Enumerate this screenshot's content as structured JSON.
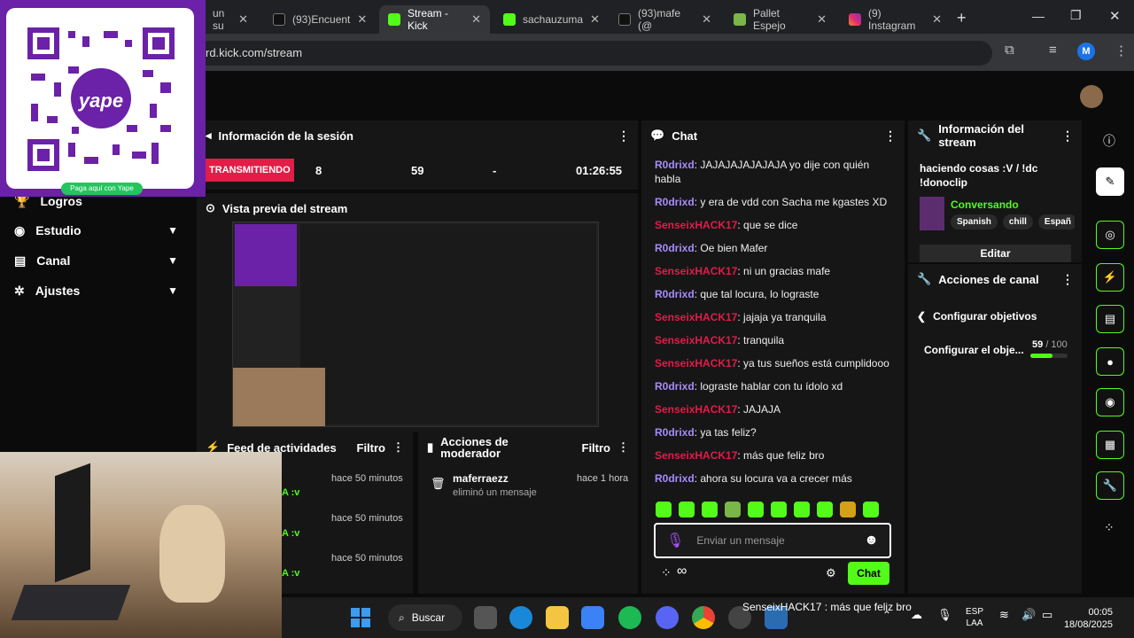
{
  "browser": {
    "tabs": [
      {
        "label": "un su",
        "icon": "globe"
      },
      {
        "label": "(93)Encuent",
        "icon": "tiktok"
      },
      {
        "label": "Stream - Kick",
        "icon": "kick",
        "active": true
      },
      {
        "label": "sachauzuma",
        "icon": "kick"
      },
      {
        "label": "(93)mafe (@",
        "icon": "tiktok"
      },
      {
        "label": "Pallet Espejo",
        "icon": "pallet"
      },
      {
        "label": "(9) Instagram",
        "icon": "instagram"
      }
    ],
    "url": "rd.kick.com/stream",
    "profile_initial": "M"
  },
  "qr": {
    "brand": "yape",
    "caption": "Paga aquí con Yape"
  },
  "sidebar": {
    "items": [
      {
        "label": "Logros"
      },
      {
        "label": "Estudio"
      },
      {
        "label": "Canal"
      },
      {
        "label": "Ajustes"
      }
    ]
  },
  "session": {
    "title": "Información de la sesión",
    "status": "TRANSMITIENDO",
    "viewers": "8",
    "followers": "59",
    "subs": "-",
    "time": "01:26:55"
  },
  "preview": {
    "title": "Vista previa del stream"
  },
  "feed": {
    "title": "Feed de actividades",
    "filter": "Filtro",
    "items": [
      {
        "time": "hace 50 minutos",
        "text": "A :v"
      },
      {
        "time": "hace 50 minutos",
        "text": "A :v"
      },
      {
        "time": "hace 50 minutos",
        "text": "A :v"
      }
    ]
  },
  "mod": {
    "title": "Acciones de moderador",
    "filter": "Filtro",
    "user": "maferraezz",
    "action": "eliminó un mensaje",
    "time": "hace 1 hora"
  },
  "chat": {
    "title": "Chat",
    "messages": [
      {
        "user": "R0drixd",
        "color": "#a78bfa",
        "text": "JAJAJAJAJAJAJA yo dije con quién habla"
      },
      {
        "user": "R0drixd",
        "color": "#a78bfa",
        "text": "y era de vdd con Sacha me kgastes XD"
      },
      {
        "user": "SenseixHACK17",
        "color": "#e11d48",
        "text": "que se dice"
      },
      {
        "user": "R0drixd",
        "color": "#a78bfa",
        "text": "Oe bien Mafer"
      },
      {
        "user": "SenseixHACK17",
        "color": "#e11d48",
        "text": "ni un gracias mafe"
      },
      {
        "user": "R0drixd",
        "color": "#a78bfa",
        "text": "que tal locura, lo lograste"
      },
      {
        "user": "SenseixHACK17",
        "color": "#e11d48",
        "text": "jajaja ya tranquila"
      },
      {
        "user": "SenseixHACK17",
        "color": "#e11d48",
        "text": "tranquila"
      },
      {
        "user": "SenseixHACK17",
        "color": "#e11d48",
        "text": "ya tus sueños está cumplidooo"
      },
      {
        "user": "R0drixd",
        "color": "#a78bfa",
        "text": "lograste hablar con tu ídolo xd"
      },
      {
        "user": "SenseixHACK17",
        "color": "#e11d48",
        "text": "JAJAJA"
      },
      {
        "user": "R0drixd",
        "color": "#a78bfa",
        "text": "ya tas feliz?"
      },
      {
        "user": "SenseixHACK17",
        "color": "#e11d48",
        "text": "más que feliz bro"
      },
      {
        "user": "R0drixd",
        "color": "#a78bfa",
        "text": "ahora su locura va a crecer más"
      }
    ],
    "placeholder": "Enviar un mensaje",
    "send": "Chat",
    "infinity": "∞"
  },
  "stream_info": {
    "title": "Información del stream",
    "stream_title": "haciendo cosas :V / !dc !donoclip",
    "category": "Conversando",
    "tags": [
      "Spanish",
      "chill",
      "Españ"
    ],
    "edit": "Editar"
  },
  "channel": {
    "title": "Acciones de canal",
    "goals_back": "Configurar objetivos",
    "goal_label": "Configurar el obje...",
    "goal_current": "59",
    "goal_total": "/ 100",
    "goal_fraction": 0.59
  },
  "taskbar": {
    "search": "Buscar",
    "notification": "SenseixHACK17 : más que feliz bro",
    "lang1": "ESP",
    "lang2": "LAA",
    "time": "00:05",
    "date": "18/08/2025"
  },
  "colors": {
    "kick_green": "#53fc18",
    "live_red": "#e11d48"
  }
}
